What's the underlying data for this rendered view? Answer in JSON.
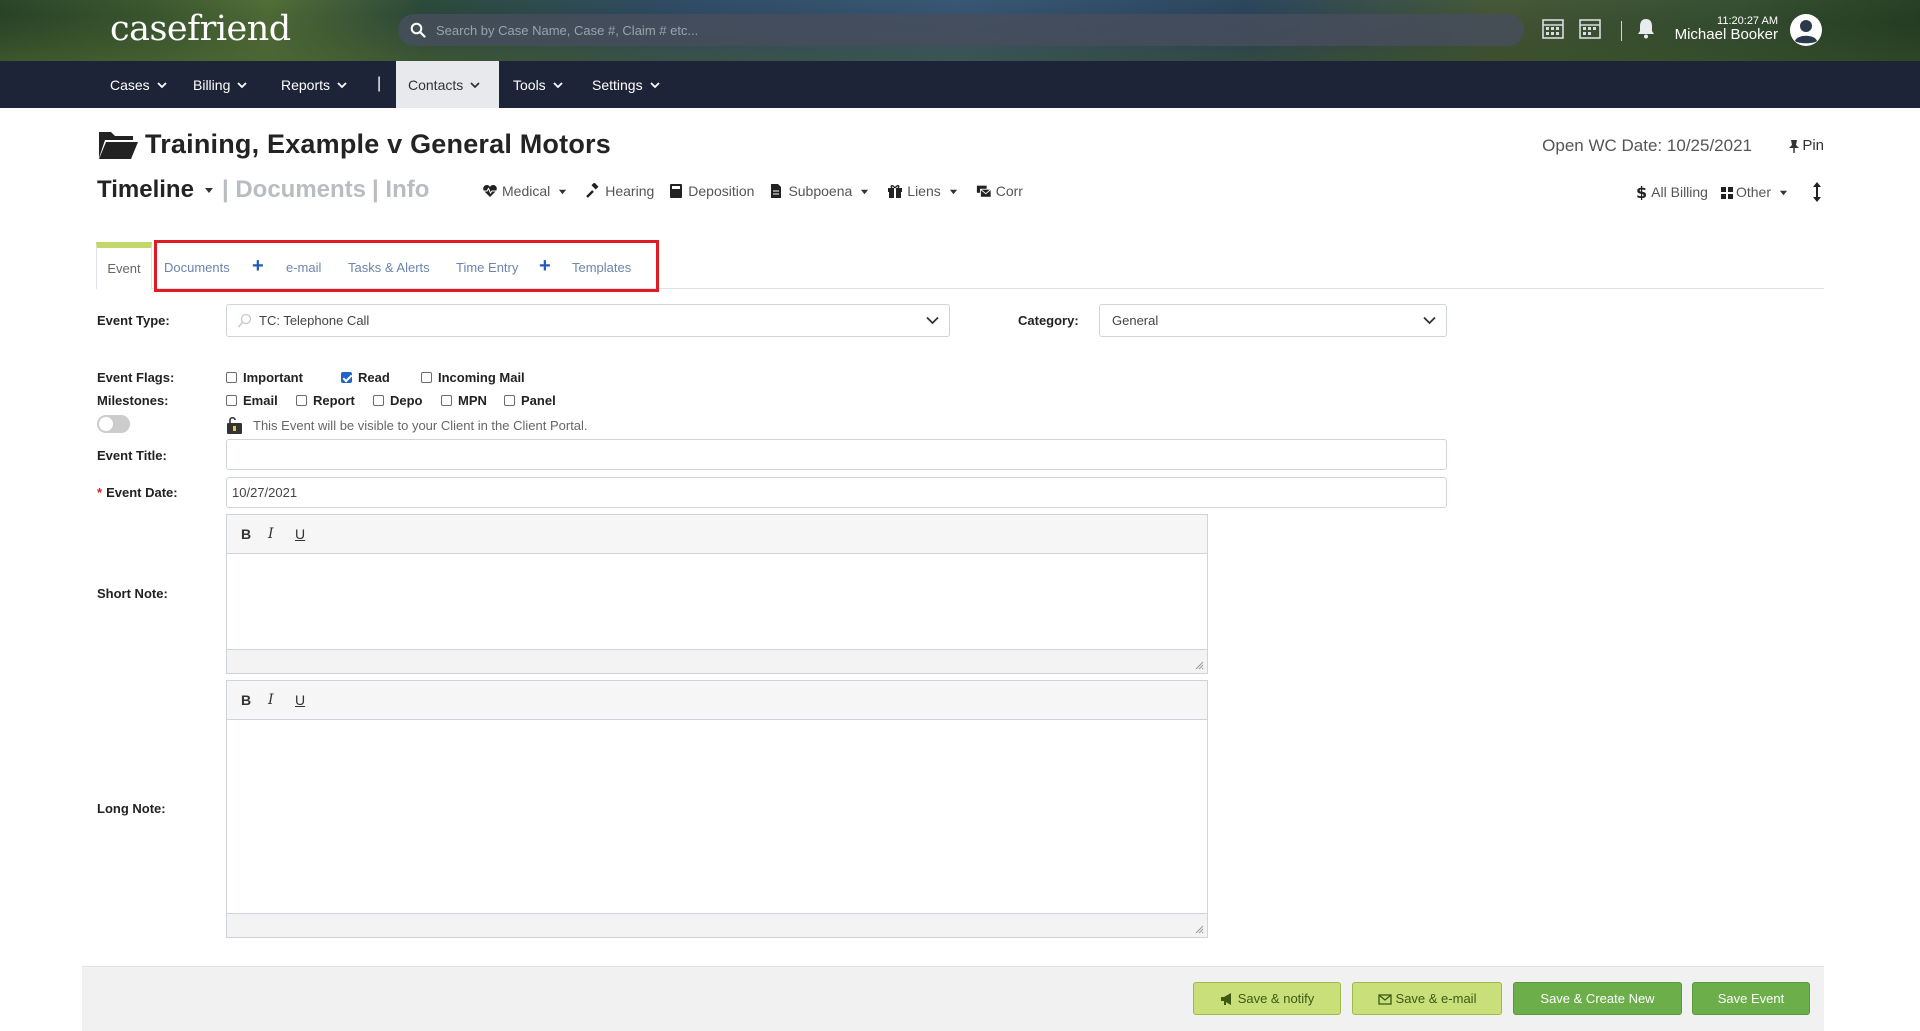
{
  "app": {
    "logo": "casefriend"
  },
  "header": {
    "search_placeholder": "Search by Case Name, Case #, Claim # etc...",
    "time": "11:20:27 AM",
    "user_name": "Michael Booker"
  },
  "nav": {
    "items": [
      {
        "label": "Cases"
      },
      {
        "label": "Billing"
      },
      {
        "label": "Reports"
      },
      {
        "label": "Contacts"
      },
      {
        "label": "Tools"
      },
      {
        "label": "Settings"
      }
    ],
    "separator": "|",
    "active": "Contacts"
  },
  "case": {
    "title": "Training, Example v General Motors",
    "open_date_label": "Open WC Date:",
    "open_date": "10/25/2021",
    "pin_label": "Pin"
  },
  "subnav": {
    "timeline": "Timeline",
    "documents": "| Documents",
    "info": "| Info",
    "quick_links": [
      {
        "label": "Medical"
      },
      {
        "label": "Hearing"
      },
      {
        "label": "Deposition"
      },
      {
        "label": "Subpoena"
      },
      {
        "label": "Liens"
      },
      {
        "label": "Corr"
      }
    ],
    "all_billing": "All Billing",
    "other": "Other"
  },
  "tabs": {
    "event": "Event",
    "documents": "Documents",
    "email": "e-mail",
    "tasks": "Tasks & Alerts",
    "time_entry": "Time Entry",
    "templates": "Templates",
    "plus": "+"
  },
  "form": {
    "event_type_label": "Event Type:",
    "event_type_value": "TC: Telephone Call",
    "category_label": "Category:",
    "category_value": "General",
    "flags_label": "Event Flags:",
    "flags": [
      {
        "label": "Important",
        "checked": false
      },
      {
        "label": "Read",
        "checked": true
      },
      {
        "label": "Incoming Mail",
        "checked": false
      }
    ],
    "milestones_label": "Milestones:",
    "milestones": [
      {
        "label": "Email",
        "checked": false
      },
      {
        "label": "Report",
        "checked": false
      },
      {
        "label": "Depo",
        "checked": false
      },
      {
        "label": "MPN",
        "checked": false
      },
      {
        "label": "Panel",
        "checked": false
      }
    ],
    "portal_text": "This Event will be visible to your Client in the Client Portal.",
    "title_label": "Event Title:",
    "title_value": "",
    "date_required": "*",
    "date_label": "Event Date:",
    "date_value": "10/27/2021",
    "short_note_label": "Short Note:",
    "long_note_label": "Long Note:",
    "editor_buttons": {
      "bold": "B",
      "italic": "I",
      "underline": "U"
    }
  },
  "footer": {
    "save_notify": "Save & notify",
    "save_email": "Save & e-mail",
    "save_create": "Save & Create New",
    "save_event": "Save Event"
  },
  "colors": {
    "nav_bg": "#1e2438",
    "tab_accent": "#c3d86a",
    "highlight": "#e01b24",
    "btn_light": "#c8df7a",
    "btn_dark": "#6cae4a",
    "link": "#6b84b0"
  }
}
